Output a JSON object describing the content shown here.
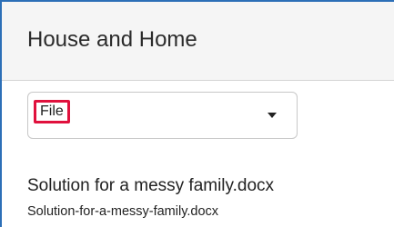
{
  "header": {
    "title": "House and Home"
  },
  "select": {
    "selected_value": "File",
    "highlight_color": "#e0113d"
  },
  "document": {
    "title": "Solution for a messy family.docx",
    "filename": "Solution-for-a-messy-family.docx"
  },
  "colors": {
    "frame_accent": "#2c6fb7",
    "header_bg": "#f5f5f5"
  },
  "icons": {
    "dropdown": "chevron-down-icon"
  }
}
